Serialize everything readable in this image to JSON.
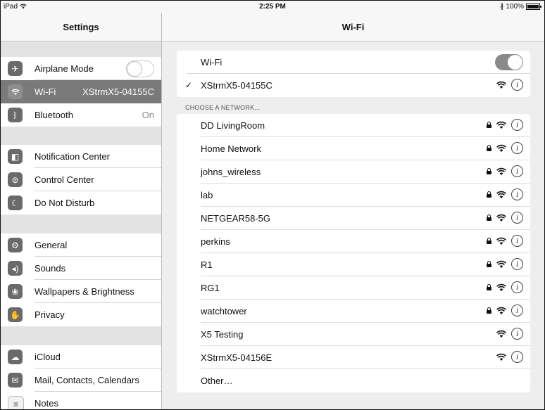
{
  "status_bar": {
    "device": "iPad",
    "time": "2:25 PM",
    "battery": "100%"
  },
  "left": {
    "title": "Settings",
    "group1": [
      {
        "icon": "airplane-icon",
        "label": "Airplane Mode",
        "value": "",
        "toggle": "off"
      },
      {
        "icon": "wifi-icon",
        "label": "Wi-Fi",
        "value": "XStrmX5-04155C",
        "selected": true
      },
      {
        "icon": "bluetooth-icon",
        "label": "Bluetooth",
        "value": "On"
      }
    ],
    "group2": [
      {
        "icon": "notification-center-icon",
        "label": "Notification Center"
      },
      {
        "icon": "control-center-icon",
        "label": "Control Center"
      },
      {
        "icon": "do-not-disturb-icon",
        "label": "Do Not Disturb"
      }
    ],
    "group3": [
      {
        "icon": "gear-icon",
        "label": "General"
      },
      {
        "icon": "sounds-icon",
        "label": "Sounds"
      },
      {
        "icon": "wallpaper-icon",
        "label": "Wallpapers & Brightness"
      },
      {
        "icon": "privacy-hand-icon",
        "label": "Privacy"
      }
    ],
    "group4": [
      {
        "icon": "icloud-icon",
        "label": "iCloud"
      },
      {
        "icon": "mail-icon",
        "label": "Mail, Contacts, Calendars"
      },
      {
        "icon": "notes-icon",
        "label": "Notes"
      }
    ]
  },
  "right": {
    "title": "Wi-Fi",
    "wifi_toggle_label": "Wi-Fi",
    "wifi_toggle_state": "on",
    "connected_network": "XStrmX5-04155C",
    "section_label": "CHOOSE A NETWORK...",
    "networks": [
      {
        "name": "DD LivingRoom",
        "secured": true
      },
      {
        "name": "Home Network",
        "secured": true
      },
      {
        "name": "johns_wireless",
        "secured": true
      },
      {
        "name": "lab",
        "secured": true
      },
      {
        "name": "NETGEAR58-5G",
        "secured": true
      },
      {
        "name": "perkins",
        "secured": true
      },
      {
        "name": "R1",
        "secured": true
      },
      {
        "name": "RG1",
        "secured": true
      },
      {
        "name": "watchtower",
        "secured": true
      },
      {
        "name": "X5 Testing",
        "secured": false
      },
      {
        "name": "XStrmX5-04156E",
        "secured": false
      }
    ],
    "other_label": "Other…"
  },
  "glyphs": {
    "check": "✓",
    "info": "i"
  },
  "colors": {
    "selected_row": "#7a7a7a",
    "toggle_on": "#8a8a8a"
  }
}
